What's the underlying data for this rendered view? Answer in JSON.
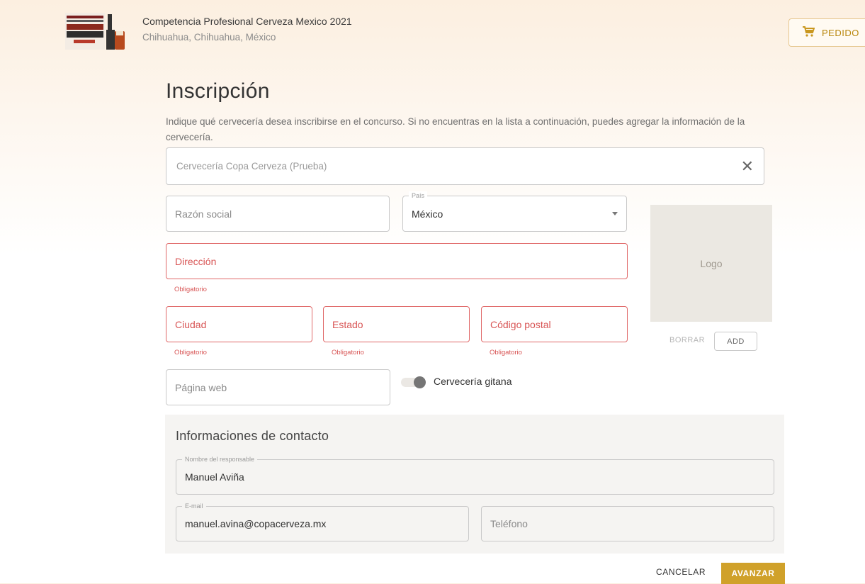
{
  "header": {
    "competition_title": "Competencia Profesional Cerveza Mexico 2021",
    "location": "Chihuahua, Chihuahua, México",
    "cart_label": "PEDIDO",
    "logo_text": [
      "COMPETENCIA",
      "PROFESIONAL",
      "CERVEZA",
      "MEXICO",
      "CHIH 2021"
    ]
  },
  "page": {
    "title": "Inscripción",
    "intro": "Indique qué cervecería desea inscribirse en el concurso. Si no encuentras en la lista a continuación, puedes agregar la información de la cervecería."
  },
  "brewery_search": {
    "value": "Cervecería Copa Cerveza (Prueba)"
  },
  "form": {
    "razon_social": {
      "placeholder": "Razón social"
    },
    "pais": {
      "legend": "País",
      "value": "México"
    },
    "direccion": {
      "placeholder": "Dirección",
      "error": "Obligatorio"
    },
    "ciudad": {
      "placeholder": "Ciudad",
      "error": "Obligatorio"
    },
    "estado": {
      "placeholder": "Estado",
      "error": "Obligatorio"
    },
    "codigo_postal": {
      "placeholder": "Código postal",
      "error": "Obligatorio"
    },
    "pagina_web": {
      "placeholder": "Página web"
    },
    "gitana": {
      "label": "Cervecería gitana",
      "checked": false
    }
  },
  "logo_panel": {
    "placeholder": "Logo",
    "delete_label": "BORRAR",
    "add_label": "ADD"
  },
  "contact": {
    "title": "Informaciones de contacto",
    "responsable": {
      "legend": "Nombre del responsable",
      "value": "Manuel Aviña"
    },
    "email": {
      "legend": "E-mail",
      "value": "manuel.avina@copacerveza.mx"
    },
    "telefono": {
      "placeholder": "Teléfono"
    }
  },
  "actions": {
    "cancel": "CANCELAR",
    "advance": "AVANZAR"
  },
  "colors": {
    "accent": "#d0a12a",
    "error": "#d85555",
    "cart": "#b8860b"
  }
}
